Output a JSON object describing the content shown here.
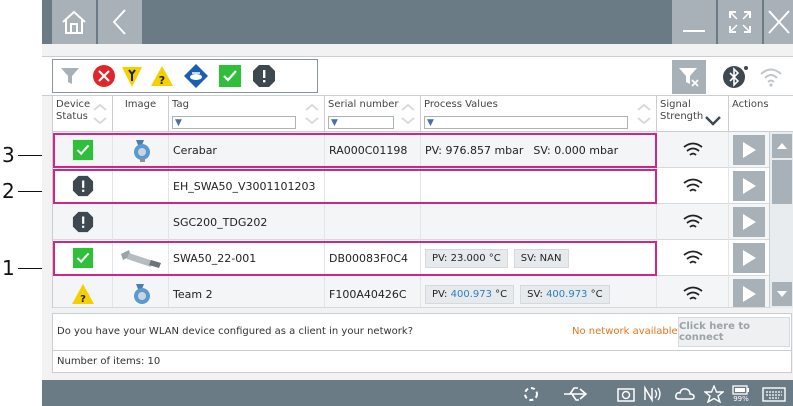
{
  "callouts": [
    "3",
    "2",
    "1"
  ],
  "filters": {
    "icons": [
      "filter-icon",
      "error-icon",
      "maintenance-icon",
      "warning-icon",
      "check-function-icon",
      "ok-icon",
      "out-of-spec-icon"
    ],
    "right_icons": [
      "clear-filter-icon",
      "bluetooth-icon",
      "wlan-icon"
    ]
  },
  "table": {
    "headers": {
      "status": "Device Status",
      "image": "Image",
      "tag": "Tag",
      "serial": "Serial number",
      "process": "Process Values",
      "signal": "Signal Strength",
      "actions": "Actions"
    },
    "rows": [
      {
        "status": "ok",
        "image": "cerabar",
        "tag": "Cerabar",
        "serial": "RA000C01198",
        "pv": "PV: 976.857 mbar",
        "sv": "SV: 0.000 mbar"
      },
      {
        "status": "out-of-spec",
        "image": "",
        "tag": "EH_SWA50_V3001101203",
        "serial": "",
        "pv": "",
        "sv": ""
      },
      {
        "status": "out-of-spec",
        "image": "",
        "tag": "SGC200_TDG202",
        "serial": "",
        "pv": "",
        "sv": ""
      },
      {
        "status": "ok",
        "image": "swa50",
        "tag": "SWA50_22-001",
        "serial": "DB00083F0C4",
        "pv": "PV: 23.000 °C",
        "sv": "SV: NAN"
      },
      {
        "status": "warning",
        "image": "cerabar",
        "tag": "Team 2",
        "serial": "F100A40426C",
        "pv_prefix": "PV: ",
        "pv_value": "400.973",
        "pv_unit": " °C",
        "sv_prefix": "SV: ",
        "sv_value": "400.973",
        "sv_unit": " °C"
      }
    ]
  },
  "info": {
    "question": "Do you have your WLAN device configured as a client in your network?",
    "warning": "No network available.",
    "connect_label": "Click here to connect",
    "item_count": "Number of items: 10"
  },
  "statusbar": {
    "battery": "99%"
  },
  "colors": {
    "titlebar": "#6b7b85",
    "button": "#a7b1b7",
    "highlight": "#d0268a",
    "ok": "#2fbf3a",
    "error": "#e0262b",
    "warning": "#f5d000",
    "info": "#1a5fb4",
    "orange_text": "#e8751a"
  }
}
